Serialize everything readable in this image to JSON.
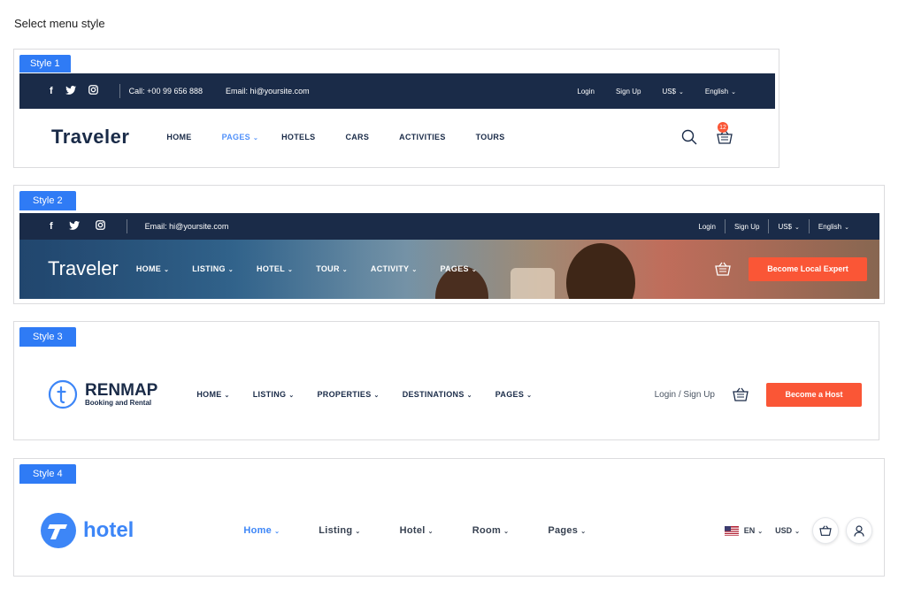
{
  "page_title": "Select menu style",
  "style1": {
    "tag": "Style 1",
    "call": "Call: +00 99 656 888",
    "email": "Email: hi@yoursite.com",
    "login": "Login",
    "signup": "Sign Up",
    "currency": "US$",
    "language": "English",
    "logo": "Traveler",
    "nav": [
      "HOME",
      "PAGES",
      "HOTELS",
      "CARS",
      "ACTIVITIES",
      "TOURS"
    ],
    "cart_count": "12"
  },
  "style2": {
    "tag": "Style 2",
    "email": "Email: hi@yoursite.com",
    "login": "Login",
    "signup": "Sign Up",
    "currency": "US$",
    "language": "English",
    "logo": "Traveler",
    "nav": [
      "HOME",
      "LISTING",
      "HOTEL",
      "TOUR",
      "ACTIVITY",
      "PAGES"
    ],
    "cta": "Become Local Expert"
  },
  "style3": {
    "tag": "Style 3",
    "logo": "RENMAP",
    "logo_sub": "Booking and Rental",
    "nav": [
      "HOME",
      "LISTING",
      "PROPERTIES",
      "DESTINATIONS",
      "PAGES"
    ],
    "auth": "Login / Sign Up",
    "cta": "Become a Host"
  },
  "style4": {
    "tag": "Style 4",
    "logo": "hotel",
    "nav": [
      "Home",
      "Listing",
      "Hotel",
      "Room",
      "Pages"
    ],
    "language": "EN",
    "currency": "USD"
  },
  "colors": {
    "accent": "#2f7bf5",
    "navy": "#1a2b48",
    "orange": "#fa5636",
    "active": "#5191fa"
  }
}
